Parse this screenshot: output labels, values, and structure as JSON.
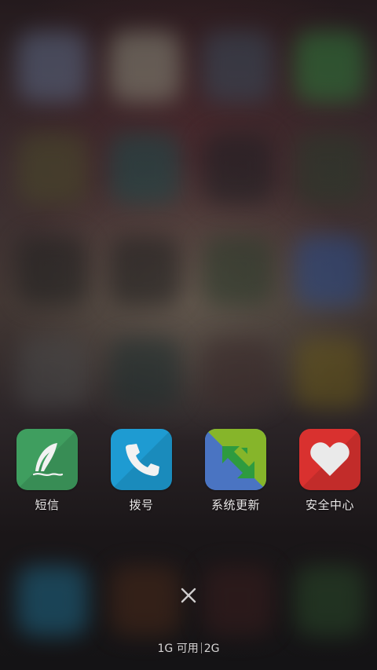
{
  "dock": {
    "apps": [
      {
        "label": "短信",
        "icon": "feather-icon",
        "color": "#3f9e5f"
      },
      {
        "label": "拨号",
        "icon": "phone-icon",
        "color": "#1e9bd2"
      },
      {
        "label": "系统更新",
        "icon": "update-arrows-icon",
        "color": "#4f7fc8"
      },
      {
        "label": "安全中心",
        "icon": "heart-icon",
        "color": "#d9312f"
      }
    ]
  },
  "close": {
    "icon": "close-icon"
  },
  "memory": {
    "available": "1G 可用",
    "total": "2G"
  }
}
